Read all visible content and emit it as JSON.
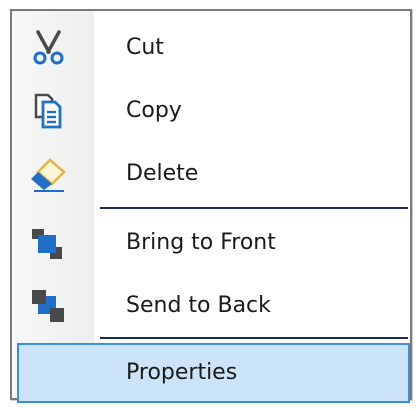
{
  "context_menu": {
    "items": [
      {
        "label": "Cut",
        "icon": "scissors-icon"
      },
      {
        "label": "Copy",
        "icon": "copy-icon"
      },
      {
        "label": "Delete",
        "icon": "eraser-icon"
      },
      {
        "label": "Bring to Front",
        "icon": "bring-to-front-icon"
      },
      {
        "label": "Send to Back",
        "icon": "send-to-back-icon"
      },
      {
        "label": "Properties",
        "icon": "",
        "highlighted": true
      }
    ]
  },
  "colors": {
    "highlight_bg": "#cce4f7",
    "highlight_border": "#3a8fd8",
    "icon_blue": "#1f6fc9",
    "icon_dark": "#4a4a4a",
    "eraser_yellow": "#f3d27a",
    "separator": "#1c2a5c"
  }
}
